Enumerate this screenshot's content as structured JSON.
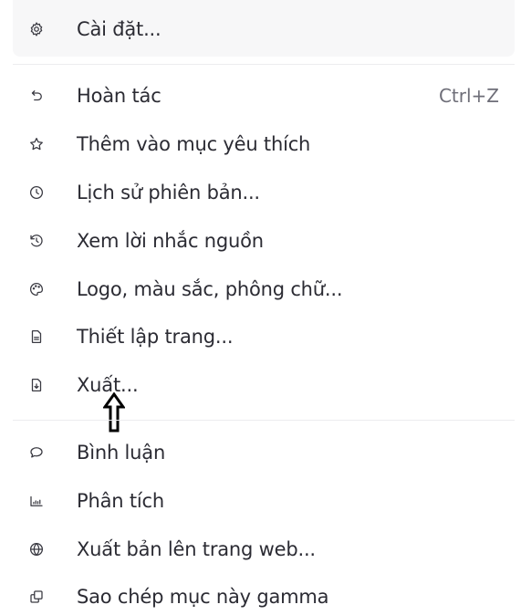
{
  "menu": {
    "settings": {
      "label": "Cài đặt...",
      "icon": "gear-icon"
    },
    "undo": {
      "label": "Hoàn tác",
      "shortcut": "Ctrl+Z",
      "icon": "undo-icon"
    },
    "favorite": {
      "label": "Thêm vào mục yêu thích",
      "icon": "star-icon"
    },
    "history": {
      "label": "Lịch sử phiên bản...",
      "icon": "clock-icon"
    },
    "source_prompt": {
      "label": "Xem lời nhắc nguồn",
      "icon": "history-arrow-icon"
    },
    "branding": {
      "label": "Logo, màu sắc, phông chữ...",
      "icon": "palette-icon"
    },
    "page_setup": {
      "label": "Thiết lập trang...",
      "icon": "document-icon"
    },
    "export": {
      "label": "Xuất...",
      "icon": "export-document-icon"
    },
    "comment": {
      "label": "Bình luận",
      "icon": "comment-icon"
    },
    "analytics": {
      "label": "Phân tích",
      "icon": "chart-icon"
    },
    "publish": {
      "label": "Xuất bản lên trang web...",
      "icon": "globe-icon"
    },
    "duplicate": {
      "label": "Sao chép mục này gamma",
      "icon": "copy-icon"
    }
  }
}
